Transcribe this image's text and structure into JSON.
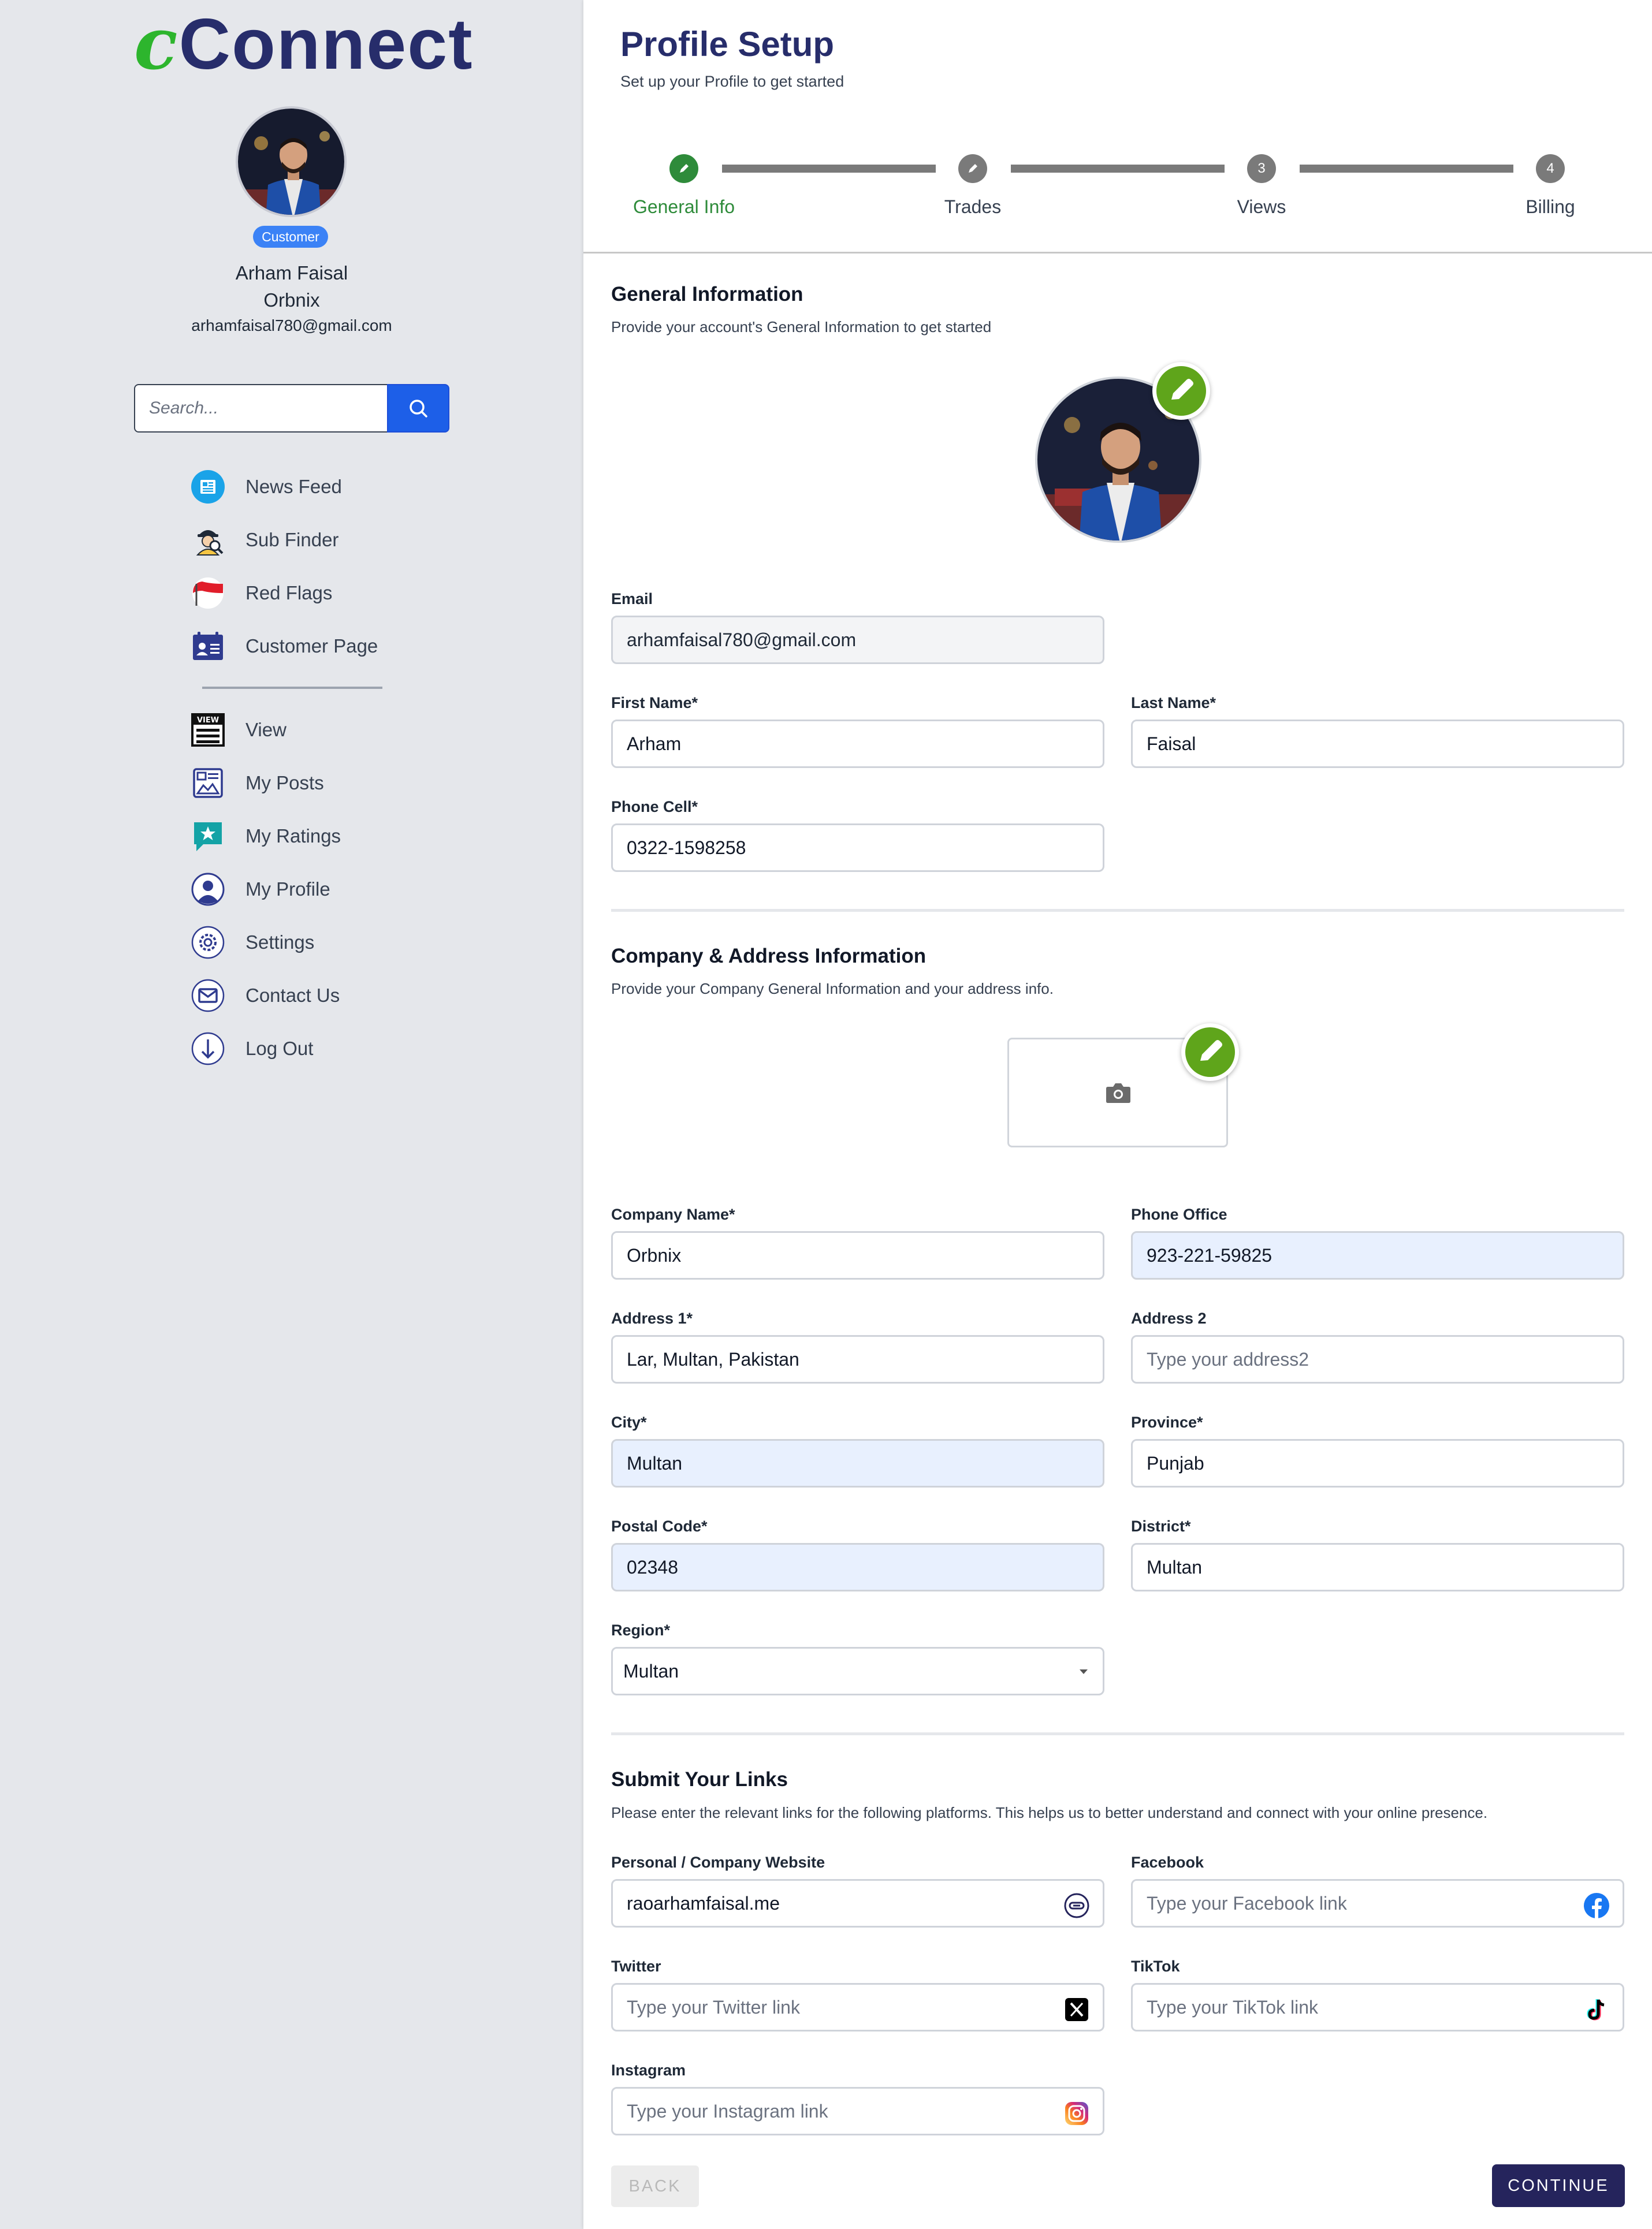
{
  "brand": {
    "logo_c": "c",
    "logo_rest": "Connect"
  },
  "user": {
    "role": "Customer",
    "name": "Arham Faisal",
    "company": "Orbnix",
    "email": "arhamfaisal780@gmail.com"
  },
  "search": {
    "placeholder": "Search...",
    "icon": "search-icon"
  },
  "nav": {
    "primary": [
      {
        "label": "News Feed",
        "icon": "news-feed-icon"
      },
      {
        "label": "Sub Finder",
        "icon": "sub-finder-icon"
      },
      {
        "label": "Red Flags",
        "icon": "red-flag-icon"
      },
      {
        "label": "Customer Page",
        "icon": "customer-page-icon"
      }
    ],
    "secondary": [
      {
        "label": "View",
        "icon": "view-icon"
      },
      {
        "label": "My Posts",
        "icon": "my-posts-icon"
      },
      {
        "label": "My Ratings",
        "icon": "my-ratings-icon"
      },
      {
        "label": "My Profile",
        "icon": "my-profile-icon"
      },
      {
        "label": "Settings",
        "icon": "settings-icon"
      },
      {
        "label": "Contact Us",
        "icon": "contact-us-icon"
      },
      {
        "label": "Log Out",
        "icon": "log-out-icon"
      }
    ]
  },
  "header": {
    "title": "Profile Setup",
    "subtitle": "Set up your Profile to get started"
  },
  "stepper": {
    "steps": [
      {
        "label": "General Info",
        "marker": "",
        "state": "done-active"
      },
      {
        "label": "Trades",
        "marker": "",
        "state": "done"
      },
      {
        "label": "Views",
        "marker": "3",
        "state": "pending"
      },
      {
        "label": "Billing",
        "marker": "4",
        "state": "pending"
      }
    ]
  },
  "general": {
    "title": "General Information",
    "subtitle": "Provide your account's General Information to get started",
    "email": {
      "label": "Email",
      "value": "arhamfaisal780@gmail.com"
    },
    "first_name": {
      "label": "First Name*",
      "value": "Arham"
    },
    "last_name": {
      "label": "Last Name*",
      "value": "Faisal"
    },
    "phone_cell": {
      "label": "Phone Cell*",
      "value": "0322-1598258"
    }
  },
  "company": {
    "title": "Company & Address Information",
    "subtitle": "Provide your Company General Information and your address info.",
    "company_name": {
      "label": "Company Name*",
      "value": "Orbnix"
    },
    "phone_office": {
      "label": "Phone Office",
      "value": "923-221-59825"
    },
    "address1": {
      "label": "Address 1*",
      "value": "Lar, Multan, Pakistan"
    },
    "address2": {
      "label": "Address 2",
      "placeholder": "Type your address2"
    },
    "city": {
      "label": "City*",
      "value": "Multan"
    },
    "province": {
      "label": "Province*",
      "value": "Punjab"
    },
    "postal_code": {
      "label": "Postal Code*",
      "value": "02348"
    },
    "district": {
      "label": "District*",
      "value": "Multan"
    },
    "region": {
      "label": "Region*",
      "value": "Multan"
    }
  },
  "links": {
    "title": "Submit Your Links",
    "subtitle": "Please enter the relevant links for the following platforms. This helps us to better understand and connect with your online presence.",
    "website": {
      "label": "Personal / Company Website",
      "value": "raoarhamfaisal.me"
    },
    "facebook": {
      "label": "Facebook",
      "placeholder": "Type your Facebook link"
    },
    "twitter": {
      "label": "Twitter",
      "placeholder": "Type your Twitter link"
    },
    "tiktok": {
      "label": "TikTok",
      "placeholder": "Type your TikTok link"
    },
    "instagram": {
      "label": "Instagram",
      "placeholder": "Type your Instagram link"
    }
  },
  "actions": {
    "back": "BACK",
    "continue": "CONTINUE"
  },
  "colors": {
    "brand_navy": "#272d6b",
    "brand_green": "#2db52d",
    "accent_blue": "#1d5fe8",
    "step_done": "#2e8b3a",
    "edit_green": "#5fa51b"
  }
}
